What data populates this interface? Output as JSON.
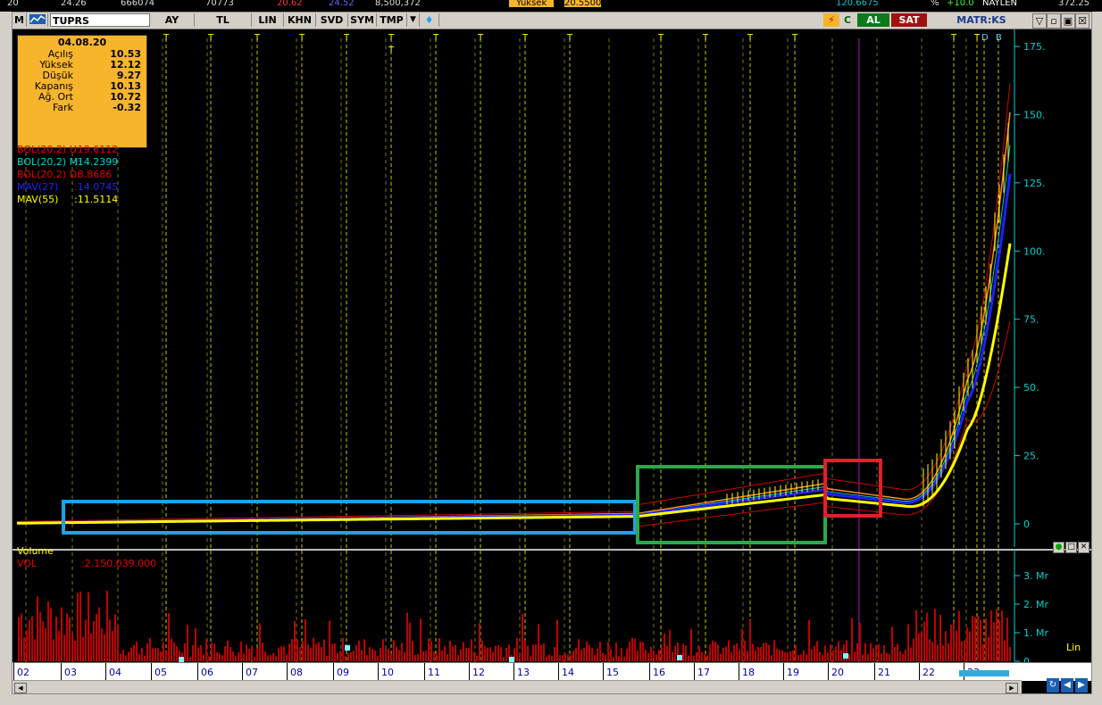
{
  "ticker_strip": {
    "values": [
      "20",
      "24.26",
      "666074",
      "70773",
      "20.62",
      "24.52",
      "8,500,372",
      "Yüksek",
      "20.5500",
      "120.6675",
      "%",
      "+10.0",
      "NAYLEN",
      "372.25"
    ]
  },
  "toolbar": {
    "menu_label": "M",
    "symbol": "TUPRS",
    "period": "AY",
    "currency": "TL",
    "buttons": [
      "LIN",
      "KHN",
      "SVD",
      "SYM",
      "TMP"
    ],
    "icons": [
      "lightning-icon",
      "c-icon"
    ],
    "buy_label": "AL",
    "sell_label": "SAT",
    "brand": "MATR:KS",
    "window_controls": [
      "▽",
      "▫",
      "▣",
      "☒"
    ]
  },
  "info_box": {
    "date": "04.08.20",
    "rows": [
      {
        "label": "Açılış",
        "value": "10.53"
      },
      {
        "label": "Yüksek",
        "value": "12.12"
      },
      {
        "label": "Düşük",
        "value": "9.27"
      },
      {
        "label": "Kapanış",
        "value": "10.13"
      },
      {
        "label": "Ağ. Ort",
        "value": "10.72"
      },
      {
        "label": "Fark",
        "value": "-0.32"
      }
    ]
  },
  "indicators": [
    {
      "name": "BOL(20,2) U:",
      "value": ":19.6112",
      "color": "#e00000"
    },
    {
      "name": "BOL(20,2) M:",
      "value": ":14.2399",
      "color": "#00d0d0"
    },
    {
      "name": "BOL(20,2) D:",
      "value": ":8.8686",
      "color": "#e00000"
    },
    {
      "name": "MAV(27)",
      "value": ":14.0745",
      "color": "#2020ff"
    },
    {
      "name": "MAV(55)",
      "value": ":11.5114",
      "color": "#ffff00"
    }
  ],
  "price_axis": {
    "ticks": [
      "175.",
      "150.",
      "125.",
      "100.",
      "75.",
      "50.",
      "25.",
      "0"
    ],
    "color": "#00d0d0"
  },
  "event_markers": [
    "T",
    "T",
    "T",
    "T",
    "T",
    "T",
    "T",
    "T",
    "T",
    "T",
    "T",
    "T",
    "T",
    "T",
    "T",
    "T",
    "D",
    "B",
    "T"
  ],
  "volume_panel": {
    "title": "Volume",
    "vol_label": "VOL",
    "vol_value": ":2.150.039.000",
    "ticks": [
      "3. Mr",
      "2. Mr",
      "1. Mr",
      "0"
    ],
    "scale_label": "Lin",
    "buttons": [
      "●",
      "□",
      "✕"
    ]
  },
  "date_axis": {
    "labels": [
      "02",
      "03",
      "04",
      "05",
      "06",
      "07",
      "08",
      "09",
      "10",
      "11",
      "12",
      "13",
      "14",
      "15",
      "16",
      "17",
      "18",
      "19",
      "20",
      "21",
      "22",
      "23"
    ]
  },
  "highlight_boxes": [
    {
      "name": "consolidation-box",
      "color": "#1aa3e8"
    },
    {
      "name": "breakout-box",
      "color": "#2aa84a"
    },
    {
      "name": "pullback-box",
      "color": "#e0202a"
    }
  ]
}
